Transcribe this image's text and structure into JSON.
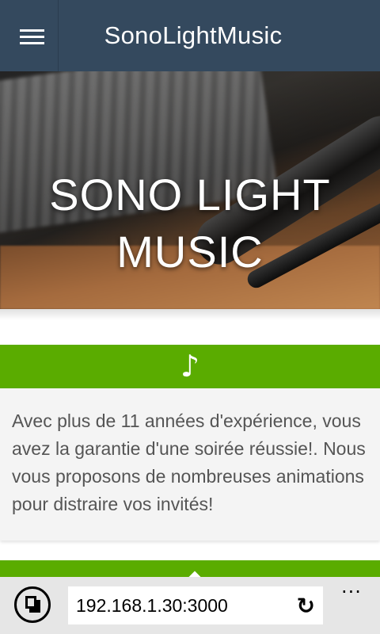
{
  "app": {
    "brand": "SonoLightMusic"
  },
  "hero": {
    "title_line1": "SONO LIGHT",
    "title_line2": "MUSIC"
  },
  "card": {
    "icon": "music-note-icon",
    "icon_glyph": "♪",
    "text": "Avec plus de 11 années d'expérience, vous avez la garantie d'une soirée réussie!. Nous vous proposons de nombreuses animations pour distraire vos invités!"
  },
  "browser": {
    "url": "192.168.1.30:3000",
    "refresh_glyph": "↻",
    "more_glyph": "..."
  },
  "colors": {
    "topbar": "#34495e",
    "accent_green": "#5aac00",
    "card_bg": "#f4f4f4",
    "text": "#555555",
    "browser_bar": "#e6e6e6"
  }
}
